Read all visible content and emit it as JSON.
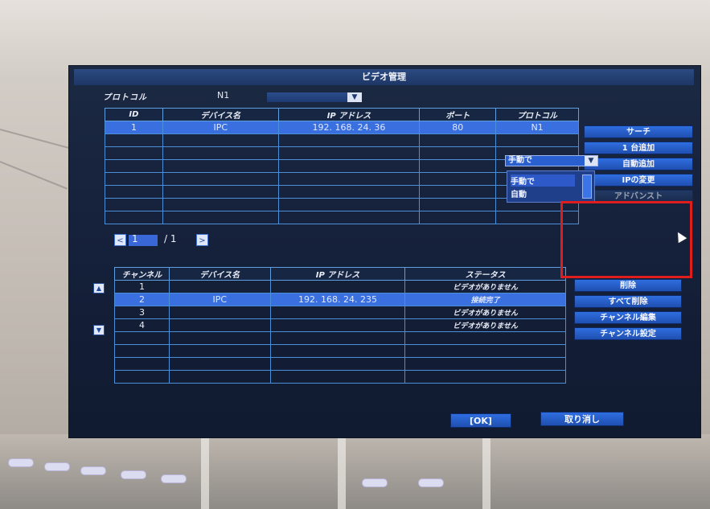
{
  "window": {
    "title": "ビデオ管理"
  },
  "protocol": {
    "label": "プロトコル",
    "value": "N1"
  },
  "device_table": {
    "headers": [
      "ID",
      "デバイス名",
      "IP アドレス",
      "ポート",
      "プロトコル"
    ],
    "rows": [
      [
        "1",
        "IPC",
        "192. 168. 24. 36",
        "80",
        "N1"
      ],
      [
        "",
        "",
        "",
        "",
        ""
      ],
      [
        "",
        "",
        "",
        "",
        ""
      ],
      [
        "",
        "",
        "",
        "",
        ""
      ],
      [
        "",
        "",
        "",
        "",
        ""
      ],
      [
        "",
        "",
        "",
        "",
        ""
      ],
      [
        "",
        "",
        "",
        "",
        ""
      ],
      [
        "",
        "",
        "",
        "",
        ""
      ]
    ],
    "selected_row": 0
  },
  "side_buttons": {
    "search": "サーチ",
    "add_one": "1 台追加",
    "auto_add": "自動追加",
    "change_ip": "IPの変更",
    "advanced": "アドバンスト"
  },
  "pager": {
    "current": "1",
    "separator": "/ 1",
    "prev_icon": "<",
    "next_icon": ">"
  },
  "mode_select": {
    "value": "手動で",
    "options": [
      "手動で",
      "自動"
    ],
    "highlighted": 0
  },
  "channel_table": {
    "headers": [
      "チャンネル",
      "デバイス名",
      "IP アドレス",
      "ステータス"
    ],
    "rows": [
      [
        "1",
        "",
        "",
        "ビデオがありません"
      ],
      [
        "2",
        "IPC",
        "192. 168. 24. 235",
        "接続完了"
      ],
      [
        "3",
        "",
        "",
        "ビデオがありません"
      ],
      [
        "4",
        "",
        "",
        "ビデオがありません"
      ],
      [
        "",
        "",
        "",
        ""
      ],
      [
        "",
        "",
        "",
        ""
      ],
      [
        "",
        "",
        "",
        ""
      ],
      [
        "",
        "",
        "",
        ""
      ]
    ],
    "selected_row": 1
  },
  "channel_buttons": {
    "delete": "削除",
    "delete_all": "すべて削除",
    "edit_channel": "チャンネル編集",
    "channel_settings": "チャンネル設定"
  },
  "footer": {
    "ok": "[OK]",
    "cancel": "取り消し"
  },
  "colors": {
    "accent": "#2f6ee0",
    "selection": "#3a6fe0",
    "highlight_box": "#e01d1d"
  }
}
